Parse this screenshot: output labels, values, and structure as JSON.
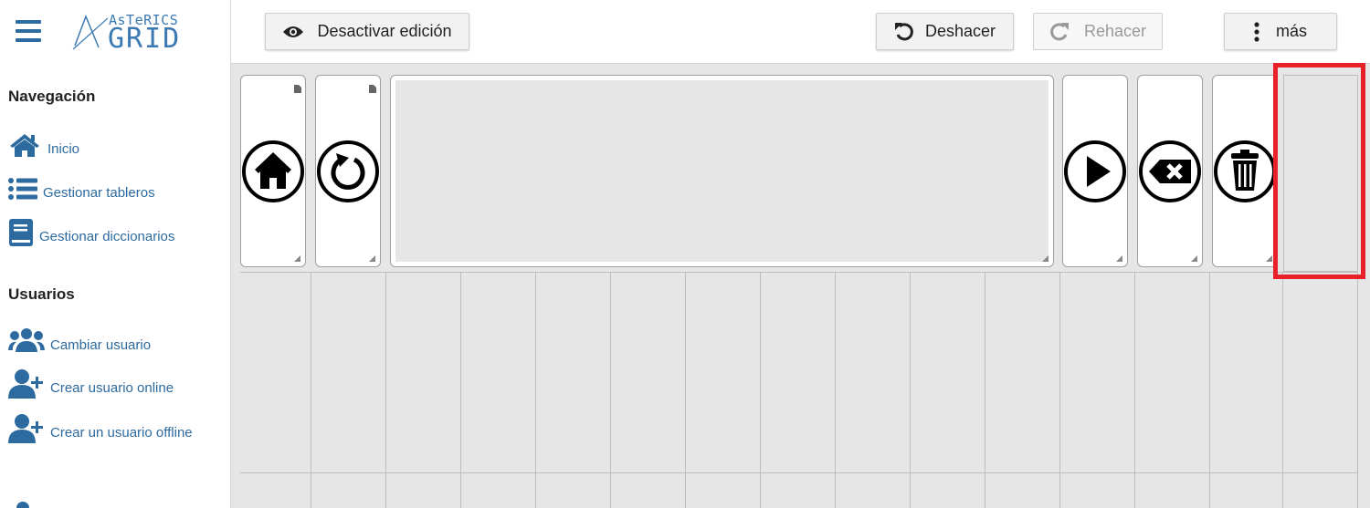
{
  "app": {
    "logo_top": "AsTeRICS",
    "logo_main": "GRID"
  },
  "sidebar": {
    "navigation_title": "Navegación",
    "navigation_items": [
      {
        "label": "Inicio",
        "icon": "home-icon"
      },
      {
        "label": "Gestionar tableros",
        "icon": "list-icon"
      },
      {
        "label": "Gestionar diccionarios",
        "icon": "book-icon"
      }
    ],
    "users_title": "Usuarios",
    "users_items": [
      {
        "label": "Cambiar usuario",
        "icon": "users-icon"
      },
      {
        "label": "Crear usuario online",
        "icon": "user-plus-icon"
      },
      {
        "label": "Crear un usuario offline",
        "icon": "user-plus-icon"
      }
    ]
  },
  "toolbar": {
    "edit_toggle_label": "Desactivar edición",
    "undo_label": "Deshacer",
    "redo_label": "Rehacer",
    "more_label": "más"
  },
  "grid": {
    "cells": [
      {
        "type": "action",
        "icon": "home-icon"
      },
      {
        "type": "action",
        "icon": "back-icon"
      },
      {
        "type": "text-collection"
      },
      {
        "type": "action",
        "icon": "play-icon"
      },
      {
        "type": "action",
        "icon": "backspace-icon"
      },
      {
        "type": "action",
        "icon": "trash-icon"
      },
      {
        "type": "empty",
        "highlighted": true
      }
    ]
  },
  "colors": {
    "accent": "#2d6a9f",
    "grid_background": "#e6e6e6",
    "highlight": "#e8202a"
  }
}
